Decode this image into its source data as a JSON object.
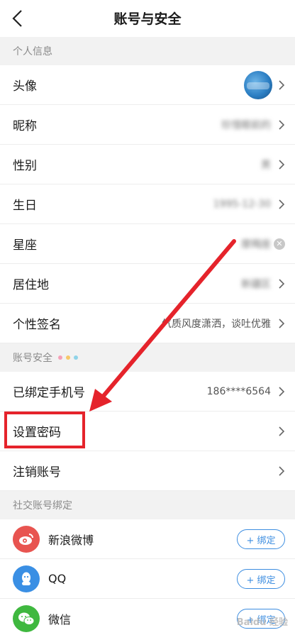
{
  "header": {
    "title": "账号与安全"
  },
  "personal": {
    "section_title": "个人信息",
    "avatar_label": "头像",
    "nickname_label": "昵称",
    "nickname_value": "珍惜眼前的",
    "gender_label": "性别",
    "gender_value": "男",
    "birthday_label": "生日",
    "birthday_value": "1995-12-30",
    "zodiac_label": "星座",
    "zodiac_value": "摩羯座",
    "residence_label": "居住地",
    "residence_value": "新疆区",
    "signature_label": "个性签名",
    "signature_value": "气质风度潇洒，谈吐优雅"
  },
  "security": {
    "section_title": "账号安全",
    "dot_colors": [
      "#f5a0b8",
      "#f7c86a",
      "#8fd3e8"
    ],
    "phone_label": "已绑定手机号",
    "phone_value": "186****6564",
    "password_label": "设置密码",
    "cancel_label": "注销账号"
  },
  "social": {
    "section_title": "社交账号绑定",
    "items": [
      {
        "name": "新浪微博",
        "icon": "weibo-icon",
        "color": "#e85450",
        "button": "+ 绑定"
      },
      {
        "name": "QQ",
        "icon": "qq-icon",
        "color": "#3a8fe4",
        "button": "+ 绑定"
      },
      {
        "name": "微信",
        "icon": "wechat-icon",
        "color": "#3fb83f",
        "button": "+ 绑定"
      }
    ]
  },
  "annotation": {
    "highlight_color": "#e5232b"
  }
}
